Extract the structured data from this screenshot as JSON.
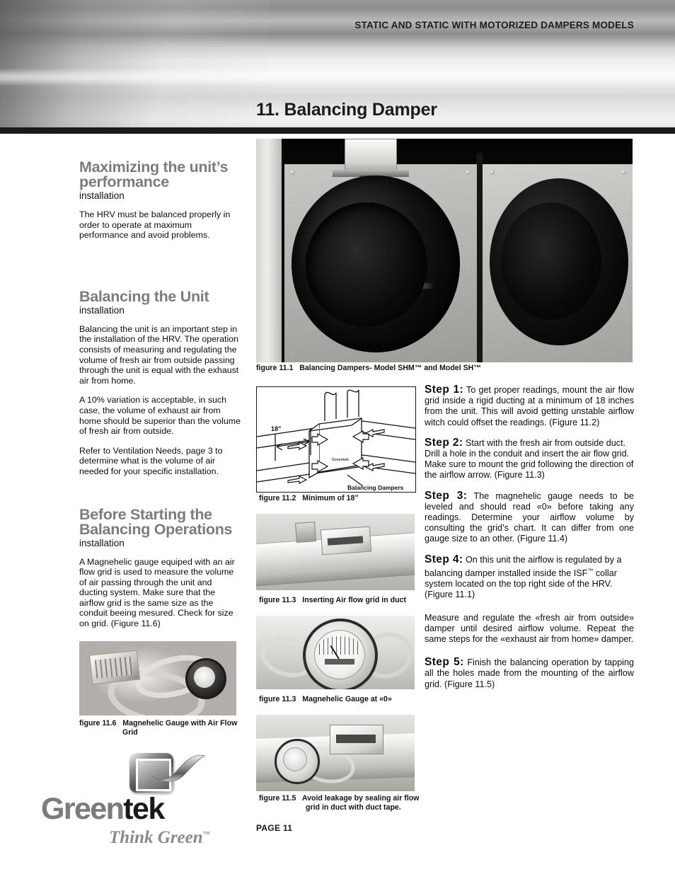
{
  "header": {
    "banner_text": "STATIC AND STATIC WITH MOTORIZED DAMPERS MODELS",
    "chapter_title": "11. Balancing Damper"
  },
  "left_column": {
    "sections": [
      {
        "heading": "Maximizing the unit’s performance",
        "subheading": "installation",
        "paragraphs": [
          "The HRV must be balanced properly in order to operate at maximum performance and avoid problems."
        ]
      },
      {
        "heading": "Balancing the Unit",
        "subheading": "installation",
        "paragraphs": [
          "Balancing the unit is an important step in the installation of the HRV.  The operation consists of measuring and regulating the volume of fresh air from outside passing through the unit is equal with the exhaust air from home.",
          "A 10% variation is acceptable, in such case, the volume of exhaust air from home should be superior than the volume of fresh air from outside.",
          "Refer to Ventilation Needs, page 3 to determine what is the volume of air needed for your specific installation."
        ]
      },
      {
        "heading": "Before Starting the Balancing Operations",
        "subheading": "installation",
        "paragraphs": [
          "A Magnehelic gauge equiped with an air flow grid is used to measure the volume of air passing through the unit and ducting system.  Make sure that the airflow grid is the same size as the conduit beeing mesured. Check for size on grid. (Figure 11.6)"
        ]
      }
    ]
  },
  "figures": {
    "fig_111": {
      "number": "figure 11.1",
      "caption": "Balancing Dampers- Model SHM™ and Model SH™"
    },
    "fig_112": {
      "number": "figure 11.2",
      "caption": "Minimum of 18”",
      "diagram_labels": {
        "dimension": "18”",
        "callout": "Balancing Dampers",
        "unit_brand": "Greentek"
      }
    },
    "fig_113": {
      "number": "figure 11.3",
      "caption": "Inserting Air flow grid in duct"
    },
    "fig_114": {
      "number": "figure 11.3",
      "caption": "Magnehelic Gauge at «0»"
    },
    "fig_115": {
      "number": "figure 11.5",
      "caption_line1": "Avoid leakage by sealing air flow",
      "caption_line2": "grid in duct with duct tape."
    },
    "fig_116": {
      "number": "figure 11.6",
      "caption_line1": "Magnehelic Gauge with Air Flow",
      "caption_line2": "Grid"
    }
  },
  "steps": [
    {
      "label": "Step 1:",
      "text": " To get proper readings, mount the air flow grid inside a rigid ducting at a minimum of 18 inches from the unit.  This will avoid getting unstable airflow witch could offset the readings. (Figure 11.2)",
      "align": "justify"
    },
    {
      "label": "Step 2:",
      "text": " Start with the fresh air from outside duct. Drill a hole in the conduit and insert the air flow grid. Make sure to mount the grid following the direction of the airflow arrow. (Figure 11.3)",
      "align": "left"
    },
    {
      "label": "Step 3:",
      "text": " The magnehelic gauge needs to be leveled and should read «0» before taking any readings. Determine your airflow volume by consulting the grid’s chart.  It can differ from one gauge size to an other. (Figure 11.4)",
      "align": "justify"
    },
    {
      "label": "Step 4:",
      "text_before_tm": " On this unit the airflow is regulated by a balancing damper installed inside the ISF",
      "tm": "™",
      "text_after_tm": " collar system located on the top right side of the HRV.  (Figure 11.1)",
      "align": "left"
    }
  ],
  "step_extra_paragraph": "Measure and regulate the «fresh air from outside» damper until desired airflow volume.  Repeat the same steps for the «exhaust air from home» damper.",
  "step_5": {
    "label": "Step 5:",
    "text": " Finish the balancing operation by tapping all the holes made from the mounting of the airflow grid. (Figure 11.5)",
    "align": "justify"
  },
  "footer": {
    "page_label": "PAGE   11",
    "logo_name_part1": "Green",
    "logo_name_part2": "tek",
    "logo_tagline": "Think Green",
    "logo_tagline_tm": "™"
  },
  "colors": {
    "heading_gray": "#7c7c7c",
    "body_black": "#0d0d0d",
    "rule_black": "#1a1a1a"
  }
}
